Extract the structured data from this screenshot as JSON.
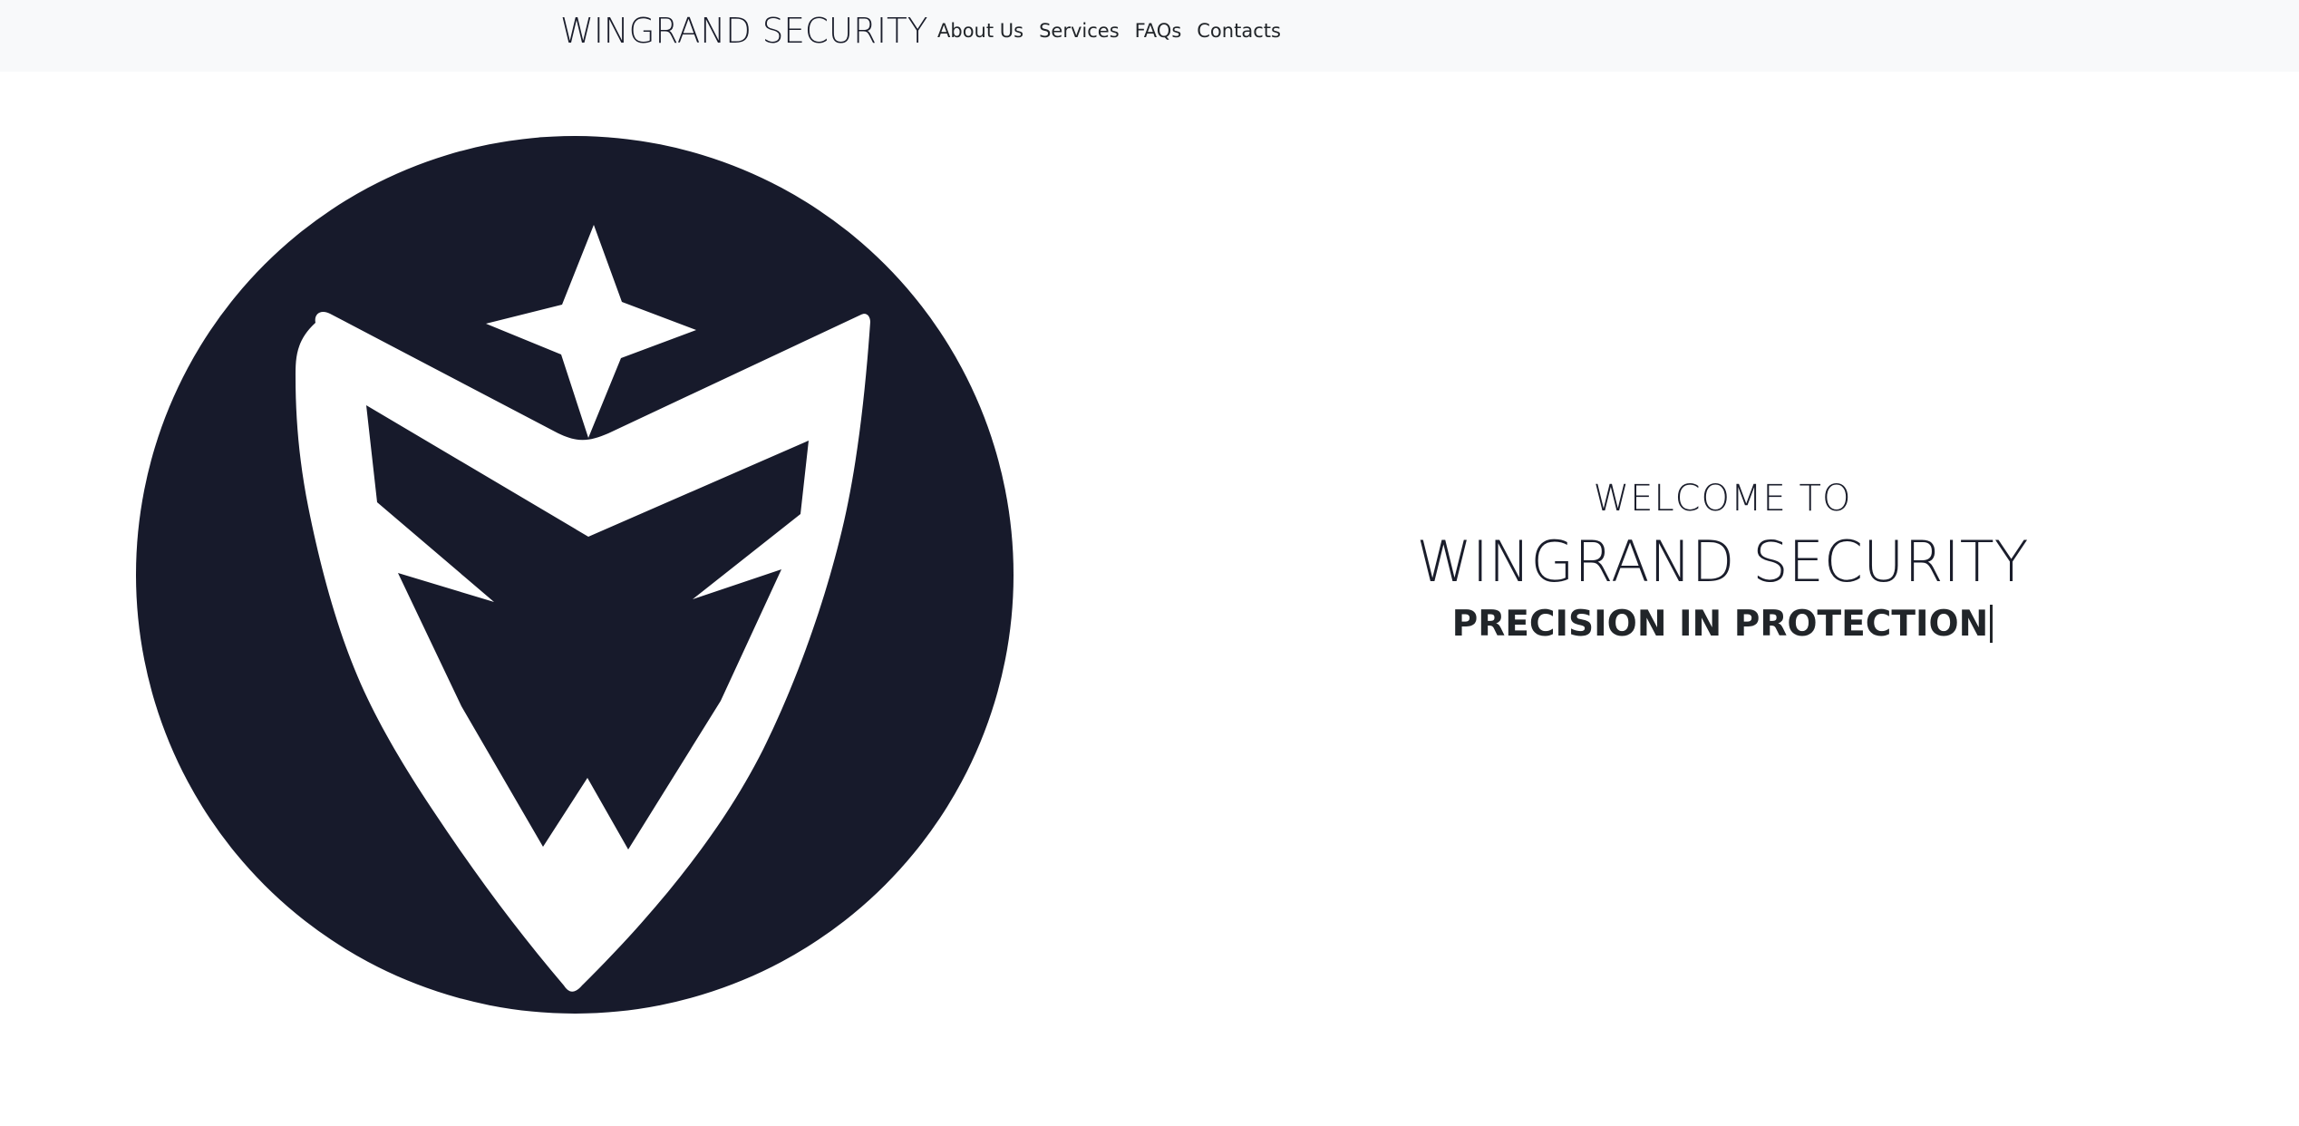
{
  "navbar": {
    "brand": "WINGRAND SECURITY",
    "links": [
      {
        "label": "About Us"
      },
      {
        "label": "Services"
      },
      {
        "label": "FAQs"
      },
      {
        "label": "Contacts"
      }
    ]
  },
  "logo": {
    "icon": "shield-wing-star-logo",
    "circle_color": "#171a2b",
    "mark_color": "#ffffff"
  },
  "hero": {
    "welcome": "WELCOME TO",
    "title": "WINGRAND SECURITY",
    "tagline": "PRECISION IN PROTECTION"
  }
}
